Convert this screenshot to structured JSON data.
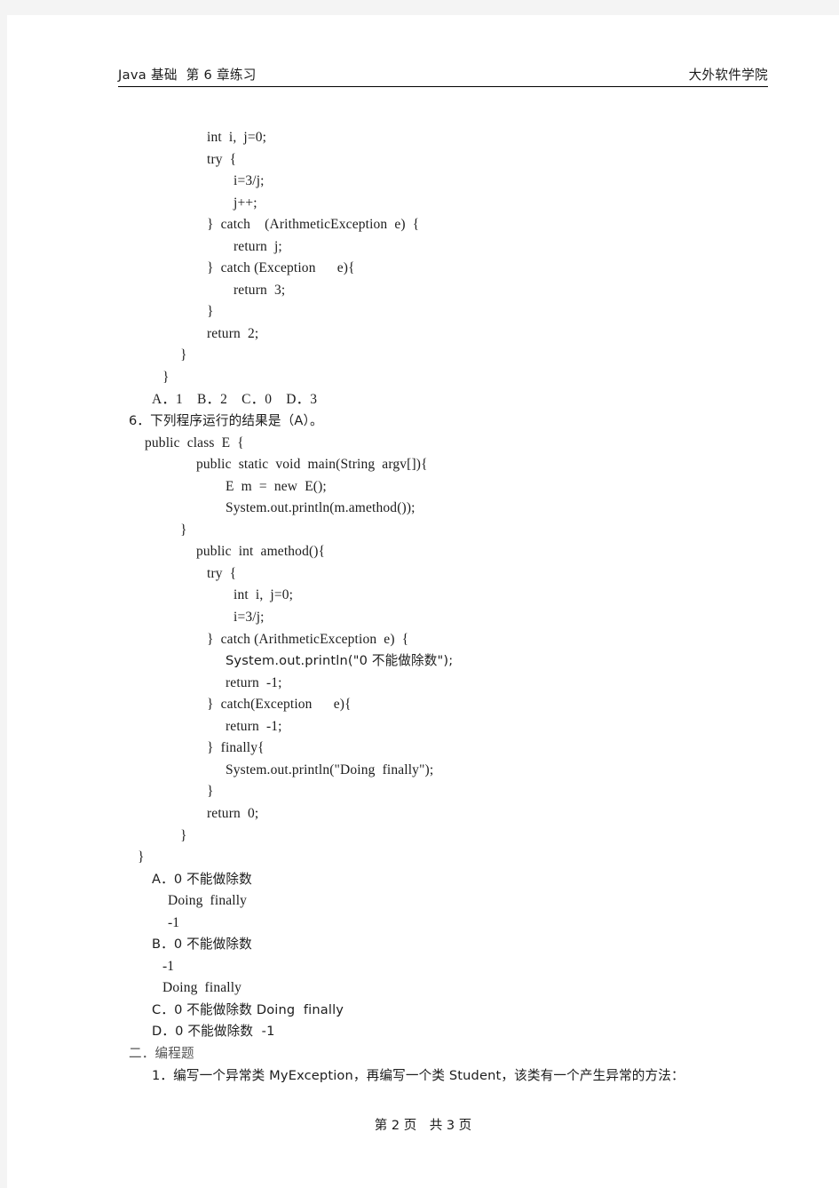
{
  "document": {
    "page_background": "#f4f4f4",
    "paper_color": "#ffffff",
    "text_color": "#1c1c1c"
  },
  "header": {
    "left": "Java 基础  第 6 章练习",
    "right": "大外软件学院"
  },
  "footer": {
    "text": "第 2 页　共 3 页"
  },
  "body": {
    "lines": [
      {
        "indent": 8,
        "text": "int  i,  j=0;"
      },
      {
        "indent": 8,
        "text": "try  {"
      },
      {
        "indent": 10,
        "text": "i=3/j;"
      },
      {
        "indent": 10,
        "text": "j++;"
      },
      {
        "indent": 8,
        "text": "}  catch    (ArithmeticException  e)  {"
      },
      {
        "indent": 10,
        "text": "return  j;"
      },
      {
        "indent": 8,
        "text": "}  catch (Exception      e){"
      },
      {
        "indent": 10,
        "text": "return  3;"
      },
      {
        "indent": 8,
        "text": "}"
      },
      {
        "indent": 8,
        "text": "return  2;"
      },
      {
        "indent": 6,
        "text": "}"
      },
      {
        "indent": 4,
        "text": "}"
      },
      {
        "indent": 3,
        "text": "A．1    B．2    C．0    D．3"
      },
      {
        "indent": 0,
        "text": "6．下列程序运行的结果是（A）。",
        "cjk": true,
        "qhead": true
      },
      {
        "indent": 2,
        "text": "public  class  E  {"
      },
      {
        "indent": 7,
        "text": "public  static  void  main(String  argv[]){"
      },
      {
        "indent": 9,
        "text": "E  m  =  new  E();"
      },
      {
        "indent": 9,
        "text": "System.out.println(m.amethod());"
      },
      {
        "indent": 6,
        "text": "}"
      },
      {
        "indent": 7,
        "text": "public  int  amethod(){"
      },
      {
        "indent": 8,
        "text": "try  {"
      },
      {
        "indent": 10,
        "text": "int  i,  j=0;"
      },
      {
        "indent": 10,
        "text": "i=3/j;"
      },
      {
        "indent": 8,
        "text": "}  catch (ArithmeticException  e)  {"
      },
      {
        "indent": 9,
        "text": "System.out.println(\"0 不能做除数\");",
        "cjk_mixed": true
      },
      {
        "indent": 9,
        "text": "return  -1;"
      },
      {
        "indent": 8,
        "text": "}  catch(Exception      e){"
      },
      {
        "indent": 9,
        "text": "return  -1;"
      },
      {
        "indent": 8,
        "text": "}  finally{"
      },
      {
        "indent": 9,
        "text": "System.out.println(\"Doing  finally\");"
      },
      {
        "indent": 8,
        "text": "}"
      },
      {
        "indent": 8,
        "text": "return  0;"
      },
      {
        "indent": 6,
        "text": "}"
      },
      {
        "indent": 1,
        "text": "}"
      },
      {
        "indent": 3,
        "text": "A．0 不能做除数",
        "cjk_mixed": true
      },
      {
        "indent": 5,
        "text": "Doing  finally"
      },
      {
        "indent": 5,
        "text": "-1"
      },
      {
        "indent": 3,
        "text": "B．0 不能做除数",
        "cjk_mixed": true
      },
      {
        "indent": 4,
        "text": "-1"
      },
      {
        "indent": 4,
        "text": "Doing  finally"
      },
      {
        "indent": 3,
        "text": "C．0 不能做除数 Doing  finally",
        "cjk_mixed": true
      },
      {
        "indent": 3,
        "text": "D．0 不能做除数  -1",
        "cjk_mixed": true
      },
      {
        "indent": 0,
        "text": "二．编程题",
        "cjk": true,
        "section": true
      },
      {
        "indent": 3,
        "text": "1．编写一个异常类 MyException，再编写一个类 Student，该类有一个产生异常的方法：",
        "cjk_mixed": true
      }
    ]
  }
}
